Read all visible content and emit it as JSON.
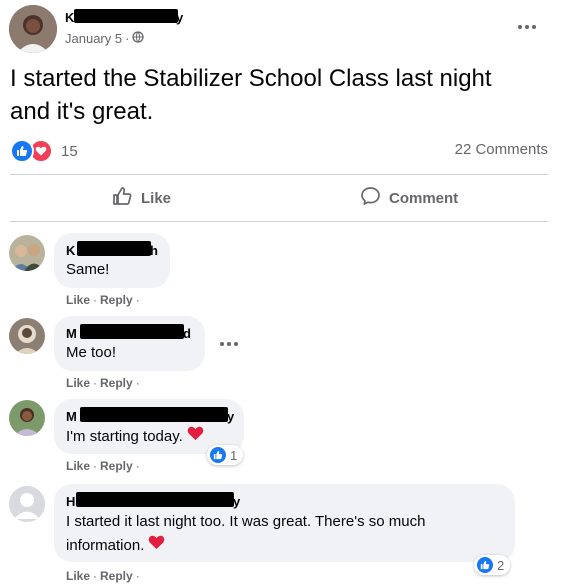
{
  "post": {
    "author_initial": "K",
    "author_suffix": "y",
    "date": "January 5",
    "date_sep": "·",
    "text": "I started the Stabilizer School Class last night and it's great.",
    "reaction_count": "15",
    "comments_count": "22 Comments",
    "like_label": "Like",
    "comment_label": "Comment",
    "icons": [
      "globe-icon",
      "more-options-icon",
      "like-reaction-icon",
      "love-reaction-icon",
      "thumbs-up-icon",
      "comment-icon"
    ]
  },
  "comments": [
    {
      "name_initial": "K",
      "name_suffix": "h",
      "text": "Same!",
      "like": "Like",
      "reply": "Reply",
      "sep": "·"
    },
    {
      "name_initial": "M",
      "name_suffix": "d",
      "text": "Me too!",
      "like": "Like",
      "reply": "Reply",
      "sep": "·"
    },
    {
      "name_initial": "M",
      "name_suffix": "y",
      "text": "I'm starting today.",
      "like": "Like",
      "reply": "Reply",
      "sep": "·",
      "reaction_count": "1"
    },
    {
      "name_initial": "H",
      "name_suffix": "y",
      "text_line1": "I started it last night too. It was great. There's so much",
      "text_line2": "information.",
      "like": "Like",
      "reply": "Reply",
      "sep": "·",
      "reaction_count": "2"
    }
  ],
  "colors": {
    "like_blue": "#1877f2",
    "love_red": "#f33e58",
    "heart_red": "#e41e3f",
    "bubble_bg": "#f0f2f5",
    "secondary_text": "#65676b"
  }
}
